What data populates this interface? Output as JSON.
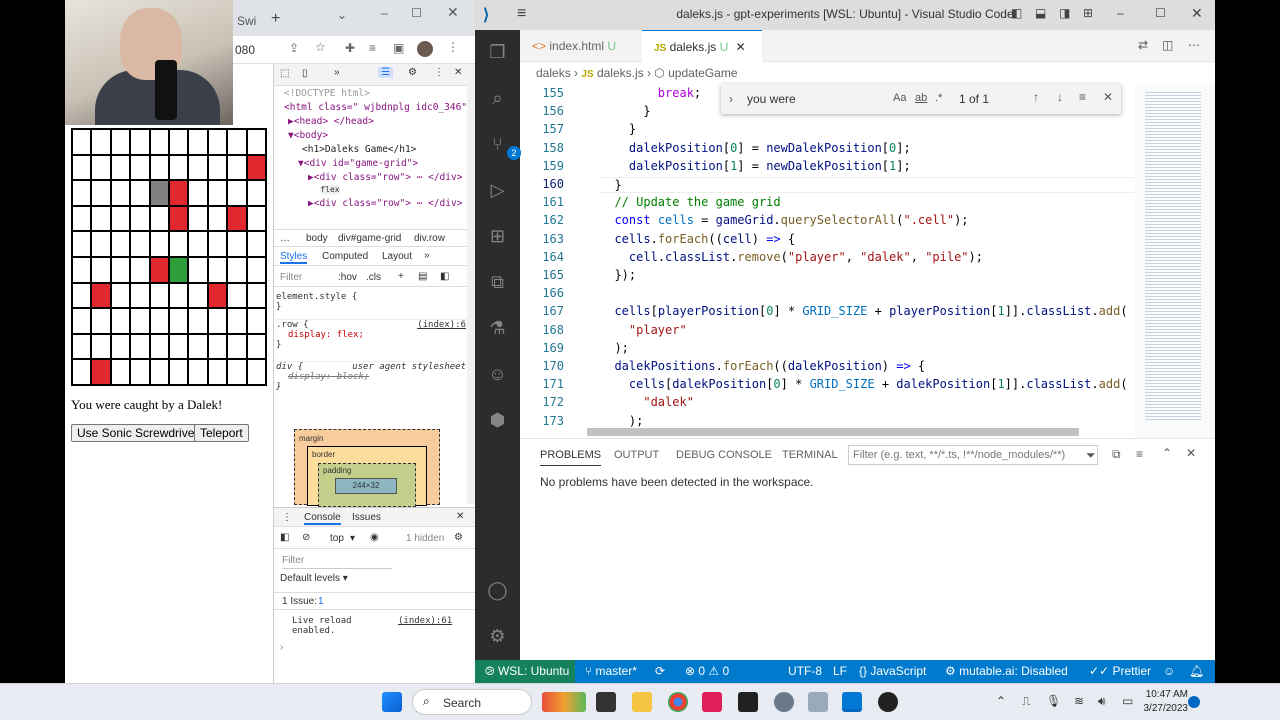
{
  "browser": {
    "tab_partial": "Swi",
    "address_partial": "080",
    "game": {
      "grid": [
        [
          "",
          "",
          "",
          "",
          "",
          "",
          "",
          "",
          "",
          ""
        ],
        [
          "",
          "",
          "",
          "",
          "",
          "",
          "",
          "",
          "",
          "dalek"
        ],
        [
          "",
          "",
          "",
          "",
          "pile",
          "dalek",
          "",
          "",
          "",
          ""
        ],
        [
          "",
          "",
          "",
          "",
          "",
          "dalek",
          "",
          "",
          "dalek",
          ""
        ],
        [
          "",
          "",
          "",
          "",
          "",
          "",
          "",
          "",
          "",
          ""
        ],
        [
          "",
          "",
          "",
          "",
          "dalek",
          "player",
          "",
          "",
          "",
          ""
        ],
        [
          "",
          "dalek",
          "",
          "",
          "",
          "",
          "",
          "dalek",
          "",
          ""
        ],
        [
          "",
          "",
          "",
          "",
          "",
          "",
          "",
          "",
          "",
          ""
        ],
        [
          "",
          "",
          "",
          "",
          "",
          "",
          "",
          "",
          "",
          ""
        ],
        [
          "",
          "dalek",
          "",
          "",
          "",
          "",
          "",
          "",
          "",
          ""
        ]
      ],
      "message": "You were caught by a Dalek!",
      "sonic_button": "Use Sonic Screwdriver",
      "teleport_button": "Teleport"
    },
    "devtools": {
      "elements": [
        "<!DOCTYPE html>",
        "<html class=\" wjbdnplg idc0_346\">",
        "▶<head> </head>",
        "▼<body>",
        "<h1>Daleks Game</h1>",
        "▼<div id=\"game-grid\">",
        "▶<div class=\"row\"> ⋯ </div>",
        "flex",
        "▶<div class=\"row\"> ⋯ </div>"
      ],
      "breadcrumb": [
        "body",
        "div#game-grid",
        "div.row"
      ],
      "styles_tabs": [
        "Styles",
        "Computed",
        "Layout"
      ],
      "filter_placeholder": "Filter",
      "hov": ":hov",
      "cls": ".cls",
      "rules": [
        {
          "selector": "element.style {",
          "decl": "",
          "source": ""
        },
        {
          "selector": ".row {",
          "decl": "display: flex;",
          "source": "(index):6"
        },
        {
          "selector": "div {",
          "decl": "display: block;",
          "source": "user agent stylesheet"
        }
      ],
      "box_model": {
        "margin": "margin",
        "border": "border",
        "padding": "padding",
        "content": "244×32"
      },
      "console_tabs": [
        "Console",
        "Issues"
      ],
      "context": "top",
      "hidden": "1 hidden",
      "console_filter": "Filter",
      "levels": "Default levels",
      "issues": "1 Issue:",
      "issues_count": "1",
      "log_text": "Live reload enabled.",
      "log_source": "(index):61"
    }
  },
  "vscode": {
    "title": "daleks.js - gpt-experiments [WSL: Ubuntu] - Visual Studio Code",
    "tabs": [
      {
        "label": "index.html",
        "status": "U"
      },
      {
        "label": "daleks.js",
        "status": "U"
      }
    ],
    "breadcrumb": [
      "daleks",
      "daleks.js",
      "updateGame"
    ],
    "find": {
      "query": "you were",
      "result": "1 of 1"
    },
    "code_lines": [
      {
        "n": "155",
        "html": "        <span class=\"ctl\">break</span>;"
      },
      {
        "n": "156",
        "html": "      }"
      },
      {
        "n": "157",
        "html": "    }"
      },
      {
        "n": "158",
        "html": "    <span class=\"var\">dalekPosition</span>[<span class=\"num\">0</span>] = <span class=\"var\">newDalekPosition</span>[<span class=\"num\">0</span>];"
      },
      {
        "n": "159",
        "html": "    <span class=\"var\">dalekPosition</span>[<span class=\"num\">1</span>] = <span class=\"var\">newDalekPosition</span>[<span class=\"num\">1</span>];"
      },
      {
        "n": "160",
        "html": "  }"
      },
      {
        "n": "161",
        "html": "  <span class=\"cm\">// Update the game grid</span>"
      },
      {
        "n": "162",
        "html": "  <span class=\"kw\">const</span> <span class=\"cls\">cells</span> = <span class=\"var\">gameGrid</span>.<span class=\"fn\">querySelectorAll</span>(<span class=\"str\">\".cell\"</span>);"
      },
      {
        "n": "163",
        "html": "  <span class=\"var\">cells</span>.<span class=\"fn\">forEach</span>((<span class=\"var\">cell</span>) <span class=\"kw\">=></span> {"
      },
      {
        "n": "164",
        "html": "    <span class=\"var\">cell</span>.<span class=\"var\">classList</span>.<span class=\"fn\">remove</span>(<span class=\"str\">\"player\"</span>, <span class=\"str\">\"dalek\"</span>, <span class=\"str\">\"pile\"</span>);"
      },
      {
        "n": "165",
        "html": "  });"
      },
      {
        "n": "166",
        "html": ""
      },
      {
        "n": "167",
        "html": "  <span class=\"var\">cells</span>[<span class=\"var\">playerPosition</span>[<span class=\"num\">0</span>] * <span class=\"cls\">GRID_SIZE</span> + <span class=\"var\">playerPosition</span>[<span class=\"num\">1</span>]].<span class=\"var\">classList</span>.<span class=\"fn\">add</span>("
      },
      {
        "n": "168",
        "html": "    <span class=\"str\">\"player\"</span>"
      },
      {
        "n": "169",
        "html": "  );"
      },
      {
        "n": "170",
        "html": "  <span class=\"var\">dalekPositions</span>.<span class=\"fn\">forEach</span>((<span class=\"var\">dalekPosition</span>) <span class=\"kw\">=></span> {"
      },
      {
        "n": "171",
        "html": "    <span class=\"var\">cells</span>[<span class=\"var\">dalekPosition</span>[<span class=\"num\">0</span>] * <span class=\"cls\">GRID_SIZE</span> + <span class=\"var\">dalekPosition</span>[<span class=\"num\">1</span>]].<span class=\"var\">classList</span>.<span class=\"fn\">add</span>("
      },
      {
        "n": "172",
        "html": "      <span class=\"str\">\"dalek\"</span>"
      },
      {
        "n": "173",
        "html": "    );"
      }
    ],
    "panel_tabs": [
      "PROBLEMS",
      "OUTPUT",
      "DEBUG CONSOLE",
      "TERMINAL"
    ],
    "panel_filter_placeholder": "Filter (e.g. text, **/*.ts, !**/node_modules/**)",
    "panel_message": "No problems have been detected in the workspace.",
    "scm_badge": "2",
    "status": {
      "remote": "WSL: Ubuntu",
      "branch": "master*",
      "errors": "0",
      "warnings": "0",
      "encoding": "UTF-8",
      "eol": "LF",
      "language": "JavaScript",
      "mutable": "mutable.ai: Disabled",
      "prettier": "Prettier"
    }
  },
  "taskbar": {
    "search": "Search",
    "time": "10:47 AM",
    "date": "3/27/2023"
  }
}
